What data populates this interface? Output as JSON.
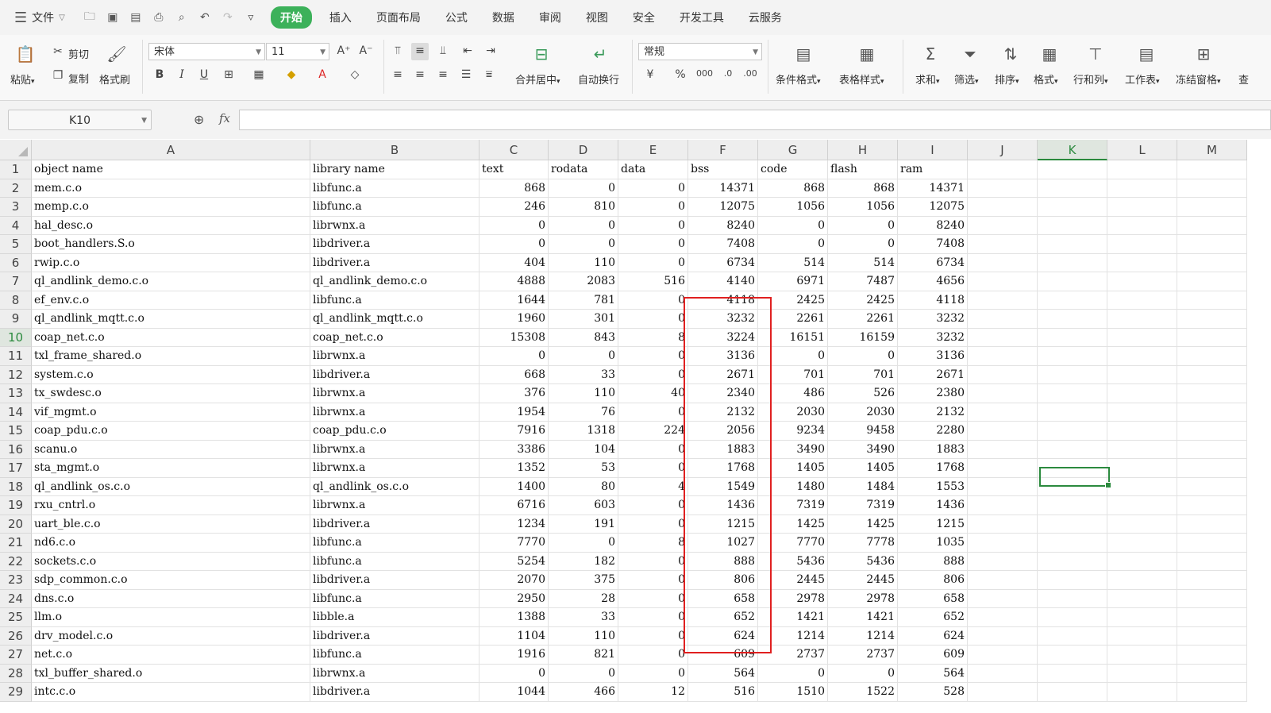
{
  "menubar": {
    "file_label": "文件",
    "tabs": [
      "开始",
      "插入",
      "页面布局",
      "公式",
      "数据",
      "审阅",
      "视图",
      "安全",
      "开发工具",
      "云服务"
    ]
  },
  "ribbon": {
    "paste": "粘贴",
    "cut": "剪切",
    "copy": "复制",
    "format_painter": "格式刷",
    "font_name": "宋体",
    "font_size": "11",
    "merge_center": "合并居中",
    "wrap_text": "自动换行",
    "number_format": "常规",
    "conditional_format": "条件格式",
    "table_style": "表格样式",
    "sum": "求和",
    "filter": "筛选",
    "sort": "排序",
    "format": "格式",
    "rows_cols": "行和列",
    "worksheet": "工作表",
    "freeze_panes": "冻结窗格",
    "overflow": "查"
  },
  "formula_bar": {
    "name_box": "K10",
    "fx": "fx",
    "formula": ""
  },
  "sheet": {
    "columns": [
      "A",
      "B",
      "C",
      "D",
      "E",
      "F",
      "G",
      "H",
      "I",
      "J",
      "K",
      "L",
      "M"
    ],
    "selected_column": "K",
    "selected_row": 10,
    "rows": [
      [
        "object name",
        "library name",
        "text",
        "rodata",
        "data",
        "bss",
        "code",
        "flash",
        "ram"
      ],
      [
        "mem.c.o",
        "libfunc.a",
        "868",
        "0",
        "0",
        "14371",
        "868",
        "868",
        "14371"
      ],
      [
        "memp.c.o",
        "libfunc.a",
        "246",
        "810",
        "0",
        "12075",
        "1056",
        "1056",
        "12075"
      ],
      [
        "hal_desc.o",
        "librwnx.a",
        "0",
        "0",
        "0",
        "8240",
        "0",
        "0",
        "8240"
      ],
      [
        "boot_handlers.S.o",
        "libdriver.a",
        "0",
        "0",
        "0",
        "7408",
        "0",
        "0",
        "7408"
      ],
      [
        "rwip.c.o",
        "libdriver.a",
        "404",
        "110",
        "0",
        "6734",
        "514",
        "514",
        "6734"
      ],
      [
        "ql_andlink_demo.c.o",
        "ql_andlink_demo.c.o",
        "4888",
        "2083",
        "516",
        "4140",
        "6971",
        "7487",
        "4656"
      ],
      [
        "ef_env.c.o",
        "libfunc.a",
        "1644",
        "781",
        "0",
        "4118",
        "2425",
        "2425",
        "4118"
      ],
      [
        "ql_andlink_mqtt.c.o",
        "ql_andlink_mqtt.c.o",
        "1960",
        "301",
        "0",
        "3232",
        "2261",
        "2261",
        "3232"
      ],
      [
        "coap_net.c.o",
        "coap_net.c.o",
        "15308",
        "843",
        "8",
        "3224",
        "16151",
        "16159",
        "3232"
      ],
      [
        "txl_frame_shared.o",
        "librwnx.a",
        "0",
        "0",
        "0",
        "3136",
        "0",
        "0",
        "3136"
      ],
      [
        "system.c.o",
        "libdriver.a",
        "668",
        "33",
        "0",
        "2671",
        "701",
        "701",
        "2671"
      ],
      [
        "tx_swdesc.o",
        "librwnx.a",
        "376",
        "110",
        "40",
        "2340",
        "486",
        "526",
        "2380"
      ],
      [
        "vif_mgmt.o",
        "librwnx.a",
        "1954",
        "76",
        "0",
        "2132",
        "2030",
        "2030",
        "2132"
      ],
      [
        "coap_pdu.c.o",
        "coap_pdu.c.o",
        "7916",
        "1318",
        "224",
        "2056",
        "9234",
        "9458",
        "2280"
      ],
      [
        "scanu.o",
        "librwnx.a",
        "3386",
        "104",
        "0",
        "1883",
        "3490",
        "3490",
        "1883"
      ],
      [
        "sta_mgmt.o",
        "librwnx.a",
        "1352",
        "53",
        "0",
        "1768",
        "1405",
        "1405",
        "1768"
      ],
      [
        "ql_andlink_os.c.o",
        "ql_andlink_os.c.o",
        "1400",
        "80",
        "4",
        "1549",
        "1480",
        "1484",
        "1553"
      ],
      [
        "rxu_cntrl.o",
        "librwnx.a",
        "6716",
        "603",
        "0",
        "1436",
        "7319",
        "7319",
        "1436"
      ],
      [
        "uart_ble.c.o",
        "libdriver.a",
        "1234",
        "191",
        "0",
        "1215",
        "1425",
        "1425",
        "1215"
      ],
      [
        "nd6.c.o",
        "libfunc.a",
        "7770",
        "0",
        "8",
        "1027",
        "7770",
        "7778",
        "1035"
      ],
      [
        "sockets.c.o",
        "libfunc.a",
        "5254",
        "182",
        "0",
        "888",
        "5436",
        "5436",
        "888"
      ],
      [
        "sdp_common.c.o",
        "libdriver.a",
        "2070",
        "375",
        "0",
        "806",
        "2445",
        "2445",
        "806"
      ],
      [
        "dns.c.o",
        "libfunc.a",
        "2950",
        "28",
        "0",
        "658",
        "2978",
        "2978",
        "658"
      ],
      [
        "llm.o",
        "libble.a",
        "1388",
        "33",
        "0",
        "652",
        "1421",
        "1421",
        "652"
      ],
      [
        "drv_model.c.o",
        "libdriver.a",
        "1104",
        "110",
        "0",
        "624",
        "1214",
        "1214",
        "624"
      ],
      [
        "net.c.o",
        "libfunc.a",
        "1916",
        "821",
        "0",
        "609",
        "2737",
        "2737",
        "609"
      ],
      [
        "txl_buffer_shared.o",
        "librwnx.a",
        "0",
        "0",
        "0",
        "564",
        "0",
        "0",
        "564"
      ],
      [
        "intc.c.o",
        "libdriver.a",
        "1044",
        "466",
        "12",
        "516",
        "1510",
        "1522",
        "528"
      ]
    ]
  }
}
